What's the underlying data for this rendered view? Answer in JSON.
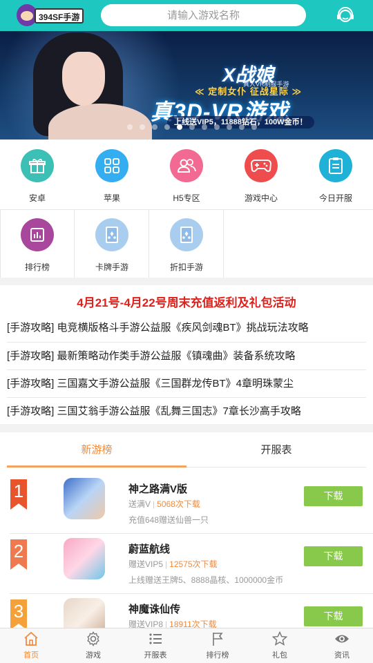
{
  "header": {
    "logo_text": "394SF手游",
    "search_placeholder": "请输入游戏名称",
    "service_icon": "customer-service-icon"
  },
  "banner": {
    "title": "X战娘",
    "subtitle": "真人VR制服手游",
    "slogan": "≪ 定制女仆  征战星际 ≫",
    "headline": "真3D-VR游戏",
    "promo": "上线送VIP5，11888钻石，100W金币！",
    "slide_count": 11,
    "active_slide": 4
  },
  "categories": [
    {
      "label": "安卓",
      "icon": "gift-icon",
      "color": "#3cbfb5"
    },
    {
      "label": "苹果",
      "icon": "grid-icon",
      "color": "#34aef0"
    },
    {
      "label": "H5专区",
      "icon": "users-icon",
      "color": "#f26a93"
    },
    {
      "label": "游戏中心",
      "icon": "gamepad-icon",
      "color": "#ef4d4d"
    },
    {
      "label": "今日开服",
      "icon": "clipboard-icon",
      "color": "#1fb2d6"
    },
    {
      "label": "排行榜",
      "icon": "bar-chart-icon",
      "color": "#a8479b"
    },
    {
      "label": "卡牌手游",
      "icon": "card-icon",
      "color": "#a9cdef"
    },
    {
      "label": "折扣手游",
      "icon": "card-icon",
      "color": "#a9cdef"
    }
  ],
  "news": {
    "headline": "4月21号-4月22号周末充值返利及礼包活动",
    "items": [
      "[手游攻略] 电竞横版格斗手游公益服《疾风剑魂BT》挑战玩法攻略",
      "[手游攻略] 最新策略动作类手游公益服《镇魂曲》装备系统攻略",
      "[手游攻略] 三国嘉文手游公益服《三国群龙传BT》4章明珠蒙尘",
      "[手游攻略] 三国艾翁手游公益服《乱舞三国志》7章长沙高手攻略"
    ]
  },
  "ranking": {
    "tabs": [
      "新游榜",
      "开服表"
    ],
    "active_tab": 0,
    "games": [
      {
        "rank": "1",
        "name": "神之路满V版",
        "tag": "送满V",
        "downloads": "5068次下载",
        "desc": "充值648赠送仙兽一只",
        "button": "下载",
        "ribbon_color": "#e8552c"
      },
      {
        "rank": "2",
        "name": "蔚蓝航线",
        "tag": "赠送VIP5",
        "downloads": "12575次下载",
        "desc": "上线赠送王牌5、8888晶核、1000000金币",
        "button": "下载",
        "ribbon_color": "#f07a4f"
      },
      {
        "rank": "3",
        "name": "神魔诛仙传",
        "tag": "赠送VIP8",
        "downloads": "18911次下载",
        "desc": "",
        "button": "下载",
        "ribbon_color": "#f5a13a"
      }
    ]
  },
  "bottom_nav": [
    {
      "label": "首页",
      "icon": "home-icon",
      "active": true
    },
    {
      "label": "游戏",
      "icon": "settings-icon",
      "active": false
    },
    {
      "label": "开服表",
      "icon": "list-icon",
      "active": false
    },
    {
      "label": "排行榜",
      "icon": "flag-icon",
      "active": false
    },
    {
      "label": "礼包",
      "icon": "star-icon",
      "active": false
    },
    {
      "label": "资讯",
      "icon": "eye-icon",
      "active": false
    }
  ],
  "colors": {
    "header": "#1ec8c0",
    "accent": "#f08a3c",
    "news_headline": "#e0201b",
    "download_button": "#88c84a"
  }
}
